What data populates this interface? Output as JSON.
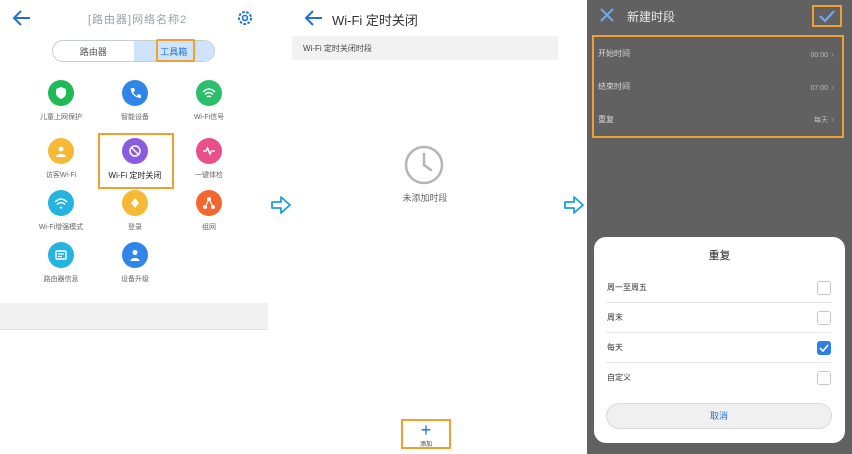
{
  "panel1": {
    "title": "[路由器]网络名称2",
    "seg_left": "路由器",
    "seg_right": "工具箱",
    "items": [
      {
        "label": "儿童上网保护",
        "color": "#1fb955",
        "icon": "shield-icon"
      },
      {
        "label": "智能设备",
        "color": "#2f86e8",
        "icon": "phone-icon"
      },
      {
        "label": "Wi-Fi信号",
        "color": "#2bbf6a",
        "icon": "wifi-icon"
      },
      {
        "label": "Wi-Fi 定时关闭",
        "color": "#8b5be0",
        "icon": "wifi-timer-icon"
      },
      {
        "label": "一键体检",
        "color": "#ea4f8a",
        "icon": "heartbeat-icon"
      },
      {
        "label": "访客Wi-Fi",
        "color": "#f5b935",
        "icon": "guest-icon"
      },
      {
        "label": "Wi-Fi增强模式",
        "color": "#25b3df",
        "icon": "wifi-boost-icon"
      },
      {
        "label": "登录",
        "color": "#f5b935",
        "icon": "login-icon"
      },
      {
        "label": "组网",
        "color": "#f4672f",
        "icon": "network-icon"
      },
      {
        "label": "路由器信息",
        "color": "#25b3df",
        "icon": "router-info-icon"
      },
      {
        "label": "设备升级",
        "color": "#2f86e8",
        "icon": "upgrade-icon"
      }
    ]
  },
  "panel2": {
    "title": "Wi-Fi 定时关闭",
    "subhead": "Wi-Fi 定时关闭时段",
    "empty_text": "未添加时段",
    "add_label": "添加"
  },
  "panel3": {
    "title": "新建时段",
    "rows": [
      {
        "label": "开始时间",
        "value": "00:00"
      },
      {
        "label": "结束时间",
        "value": "07:00"
      },
      {
        "label": "重复",
        "value": "每天"
      }
    ],
    "sheet": {
      "title": "重复",
      "options": [
        {
          "label": "周一至周五",
          "checked": false
        },
        {
          "label": "周末",
          "checked": false
        },
        {
          "label": "每天",
          "checked": true
        },
        {
          "label": "自定义",
          "checked": false
        }
      ],
      "cancel": "取消"
    }
  },
  "colors": {
    "accent": "#1f6fd6",
    "highlight": "#f0a030"
  }
}
